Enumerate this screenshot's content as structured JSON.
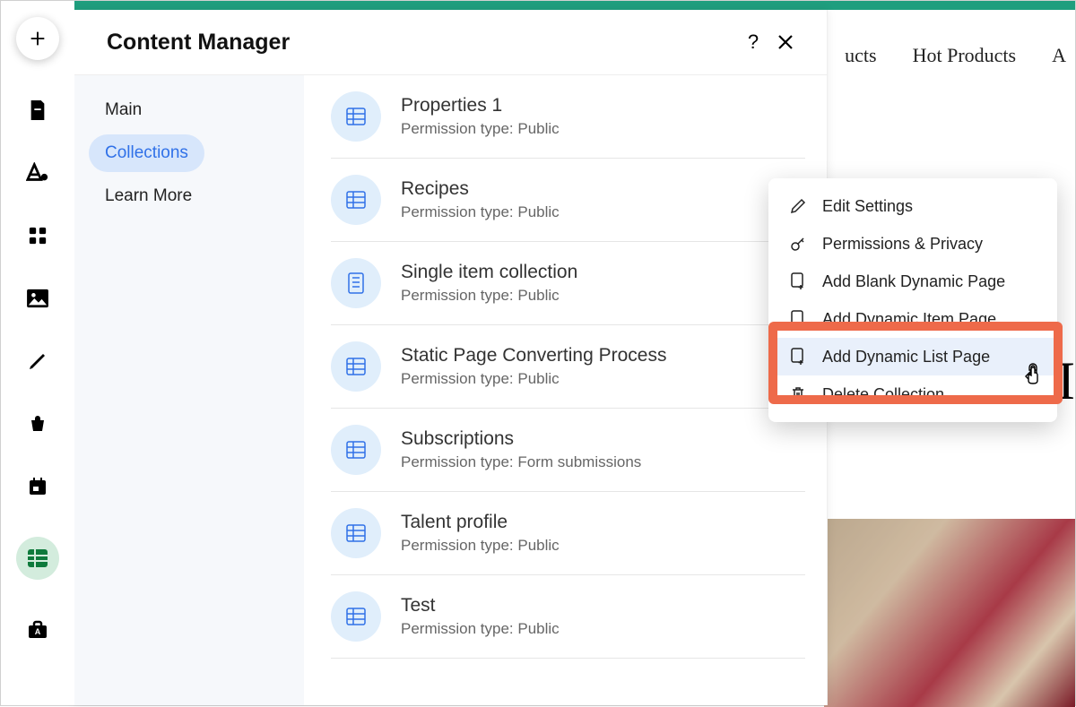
{
  "panel": {
    "title": "Content Manager",
    "help_tooltip": "?",
    "close_tooltip": "✕"
  },
  "sidebar": {
    "items": [
      {
        "label": "Main",
        "selected": false
      },
      {
        "label": "Collections",
        "selected": true
      },
      {
        "label": "Learn More",
        "selected": false
      }
    ]
  },
  "collections": [
    {
      "name": "Properties 1",
      "permission": "Permission type: Public",
      "icon": "table"
    },
    {
      "name": "Recipes",
      "permission": "Permission type: Public",
      "icon": "table",
      "menu_open": true
    },
    {
      "name": "Single item collection",
      "permission": "Permission type: Public",
      "icon": "single"
    },
    {
      "name": "Static Page Converting Process",
      "permission": "Permission type: Public",
      "icon": "table"
    },
    {
      "name": "Subscriptions",
      "permission": "Permission type: Form submissions",
      "icon": "table"
    },
    {
      "name": "Talent profile",
      "permission": "Permission type: Public",
      "icon": "table"
    },
    {
      "name": "Test",
      "permission": "Permission type: Public",
      "icon": "table"
    }
  ],
  "context_menu": {
    "items": [
      {
        "label": "Edit Settings",
        "icon": "pencil"
      },
      {
        "label": "Permissions & Privacy",
        "icon": "key"
      },
      {
        "label": "Add Blank Dynamic Page",
        "icon": "page-add"
      },
      {
        "label": "Add Dynamic Item Page",
        "icon": "page-add"
      },
      {
        "label": "Add Dynamic List Page",
        "icon": "page-add",
        "highlighted": true
      },
      {
        "label": "Delete Collection",
        "icon": "trash"
      }
    ]
  },
  "background": {
    "nav": [
      "ucts",
      "Hot Products",
      "A"
    ],
    "big_letter": "I"
  },
  "rail_icons": [
    "plus",
    "page",
    "text-drop",
    "grid",
    "image",
    "pen",
    "bag",
    "calendar",
    "table-active",
    "briefcase"
  ]
}
